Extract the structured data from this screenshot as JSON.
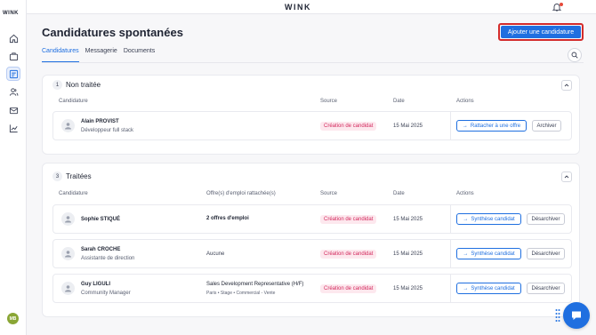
{
  "app": {
    "logo": "WINK",
    "sidebar_logo": "WINK",
    "user_initials": "MB"
  },
  "sidebar": {
    "items": [
      {
        "name": "home",
        "icon": "home-icon"
      },
      {
        "name": "jobs",
        "icon": "briefcase-icon"
      },
      {
        "name": "applications",
        "icon": "applications-icon",
        "active": true
      },
      {
        "name": "users",
        "icon": "users-icon"
      },
      {
        "name": "messages",
        "icon": "mail-icon"
      },
      {
        "name": "analytics",
        "icon": "chart-icon"
      }
    ]
  },
  "header": {
    "title": "Candidatures spontanées",
    "add_button": "Ajouter une candidature"
  },
  "tabs": [
    {
      "label": "Candidatures",
      "active": true
    },
    {
      "label": "Messagerie",
      "active": false
    },
    {
      "label": "Documents",
      "active": false
    }
  ],
  "sections": {
    "untreated": {
      "count": "1",
      "title": "Non traitée",
      "columns": {
        "candidate": "Candidature",
        "source": "Source",
        "date": "Date",
        "actions": "Actions"
      },
      "rows": [
        {
          "name": "Alain PROVIST",
          "role": "Développeur full stack",
          "source": "Création de candidat",
          "date": "15 Mai 2025",
          "primary_action": "Rattacher à une offre",
          "secondary_action": "Archiver"
        }
      ]
    },
    "treated": {
      "count": "3",
      "title": "Traitées",
      "columns": {
        "candidate": "Candidature",
        "offers": "Offre(s) d'emploi rattachée(s)",
        "source": "Source",
        "date": "Date",
        "actions": "Actions"
      },
      "rows": [
        {
          "name": "Sophie STIQUÉ",
          "role": "",
          "offer": "2 offres d'emploi",
          "offer_sub": "",
          "source": "Création de candidat",
          "date": "15 Mai 2025",
          "primary_action": "Synthèse candidat",
          "secondary_action": "Désarchiver"
        },
        {
          "name": "Sarah CROCHE",
          "role": "Assistante de direction",
          "offer": "Aucune",
          "offer_sub": "",
          "source": "Création de candidat",
          "date": "15 Mai 2025",
          "primary_action": "Synthèse candidat",
          "secondary_action": "Désarchiver"
        },
        {
          "name": "Guy LIGULI",
          "role": "Community Manager",
          "offer": "Sales Development Representative (H/F)",
          "offer_sub": "Paris • Stage • Commercial - Vente",
          "source": "Création de candidat",
          "date": "15 Mai 2025",
          "primary_action": "Synthèse candidat",
          "secondary_action": "Désarchiver"
        }
      ]
    }
  },
  "colors": {
    "accent": "#1f6fe0",
    "badge_text": "#d2285c",
    "badge_bg": "#fde8ee",
    "highlight_border": "#d32b2b",
    "avatar_green": "#8aa635"
  }
}
